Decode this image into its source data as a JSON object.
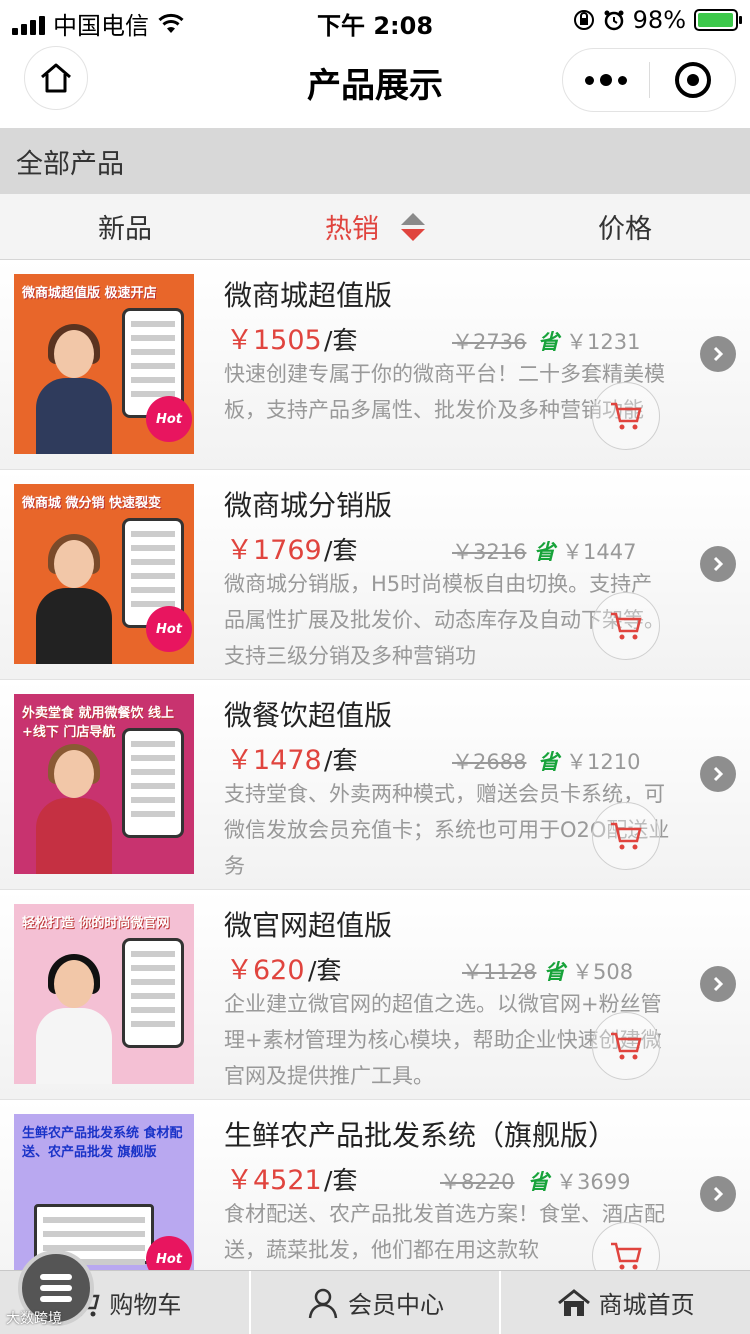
{
  "status": {
    "carrier": "中国电信",
    "time": "下午 2:08",
    "battery": "98%",
    "battery_level": 0.98
  },
  "nav": {
    "title": "产品展示"
  },
  "category": "全部产品",
  "sort": {
    "new": "新品",
    "hot": "热销",
    "price": "价格"
  },
  "products": [
    {
      "title": "微商城超值版",
      "price": "￥1505",
      "unit": "/套",
      "original": "￥2736",
      "save_label": "省",
      "deal": "￥1231",
      "desc": "快速创建专属于你的微商平台！二十多套精美模板，支持产品多属性、批发价及多种营销功能",
      "thumb_caption": "微商城超值版 极速开店",
      "thumb_bg": "#e8662a",
      "badge": "Hot"
    },
    {
      "title": "微商城分销版",
      "price": "￥1769",
      "unit": "/套",
      "original": "￥3216",
      "save_label": "省",
      "deal": "￥1447",
      "desc": "微商城分销版，H5时尚模板自由切换。支持产品属性扩展及批发价、动态库存及自动下架等。支持三级分销及多种营销功",
      "thumb_caption": "微商城 微分销 快速裂变",
      "thumb_bg": "#e8662a",
      "badge": "Hot"
    },
    {
      "title": "微餐饮超值版",
      "price": "￥1478",
      "unit": "/套",
      "original": "￥2688",
      "save_label": "省",
      "deal": "￥1210",
      "desc": "支持堂食、外卖两种模式，赠送会员卡系统，可微信发放会员充值卡；系统也可用于O2O配送业务",
      "thumb_caption": "外卖堂食 就用微餐饮 线上+线下 门店导航",
      "thumb_bg": "#c8336f",
      "badge": ""
    },
    {
      "title": "微官网超值版",
      "price": "￥620",
      "unit": "/套",
      "original": "￥1128",
      "save_label": "省",
      "deal": "￥508",
      "desc": "企业建立微官网的超值之选。以微官网+粉丝管理+素材管理为核心模块，帮助企业快速创建微官网及提供推广工具。",
      "thumb_caption": "轻松打造 你的时尚微官网",
      "thumb_bg": "#f4c0d4",
      "badge": ""
    },
    {
      "title": "生鲜农产品批发系统（旗舰版）",
      "price": "￥4521",
      "unit": "/套",
      "original": "￥8220",
      "save_label": "省",
      "deal": "￥3699",
      "desc": "食材配送、农产品批发首选方案！食堂、酒店配送，蔬菜批发，他们都在用这款软",
      "thumb_caption": "生鲜农产品批发系统 食材配送、农产品批发 旗舰版",
      "thumb_bg": "#b9a8f0",
      "badge": "Hot"
    }
  ],
  "tabs": {
    "cart": "购物车",
    "member": "会员中心",
    "home": "商城首页"
  },
  "watermark": "大数跨境",
  "colors": {
    "accent_red": "#e0443e",
    "save_green": "#17a33a",
    "battery_green": "#3cc84a"
  },
  "icons": {
    "home": "home-icon",
    "more": "more-dots-icon",
    "close": "target-icon",
    "cart": "cart-icon",
    "user": "user-icon",
    "shop": "house-icon",
    "menu": "menu-icon",
    "chevron": "chevron-right-icon"
  }
}
